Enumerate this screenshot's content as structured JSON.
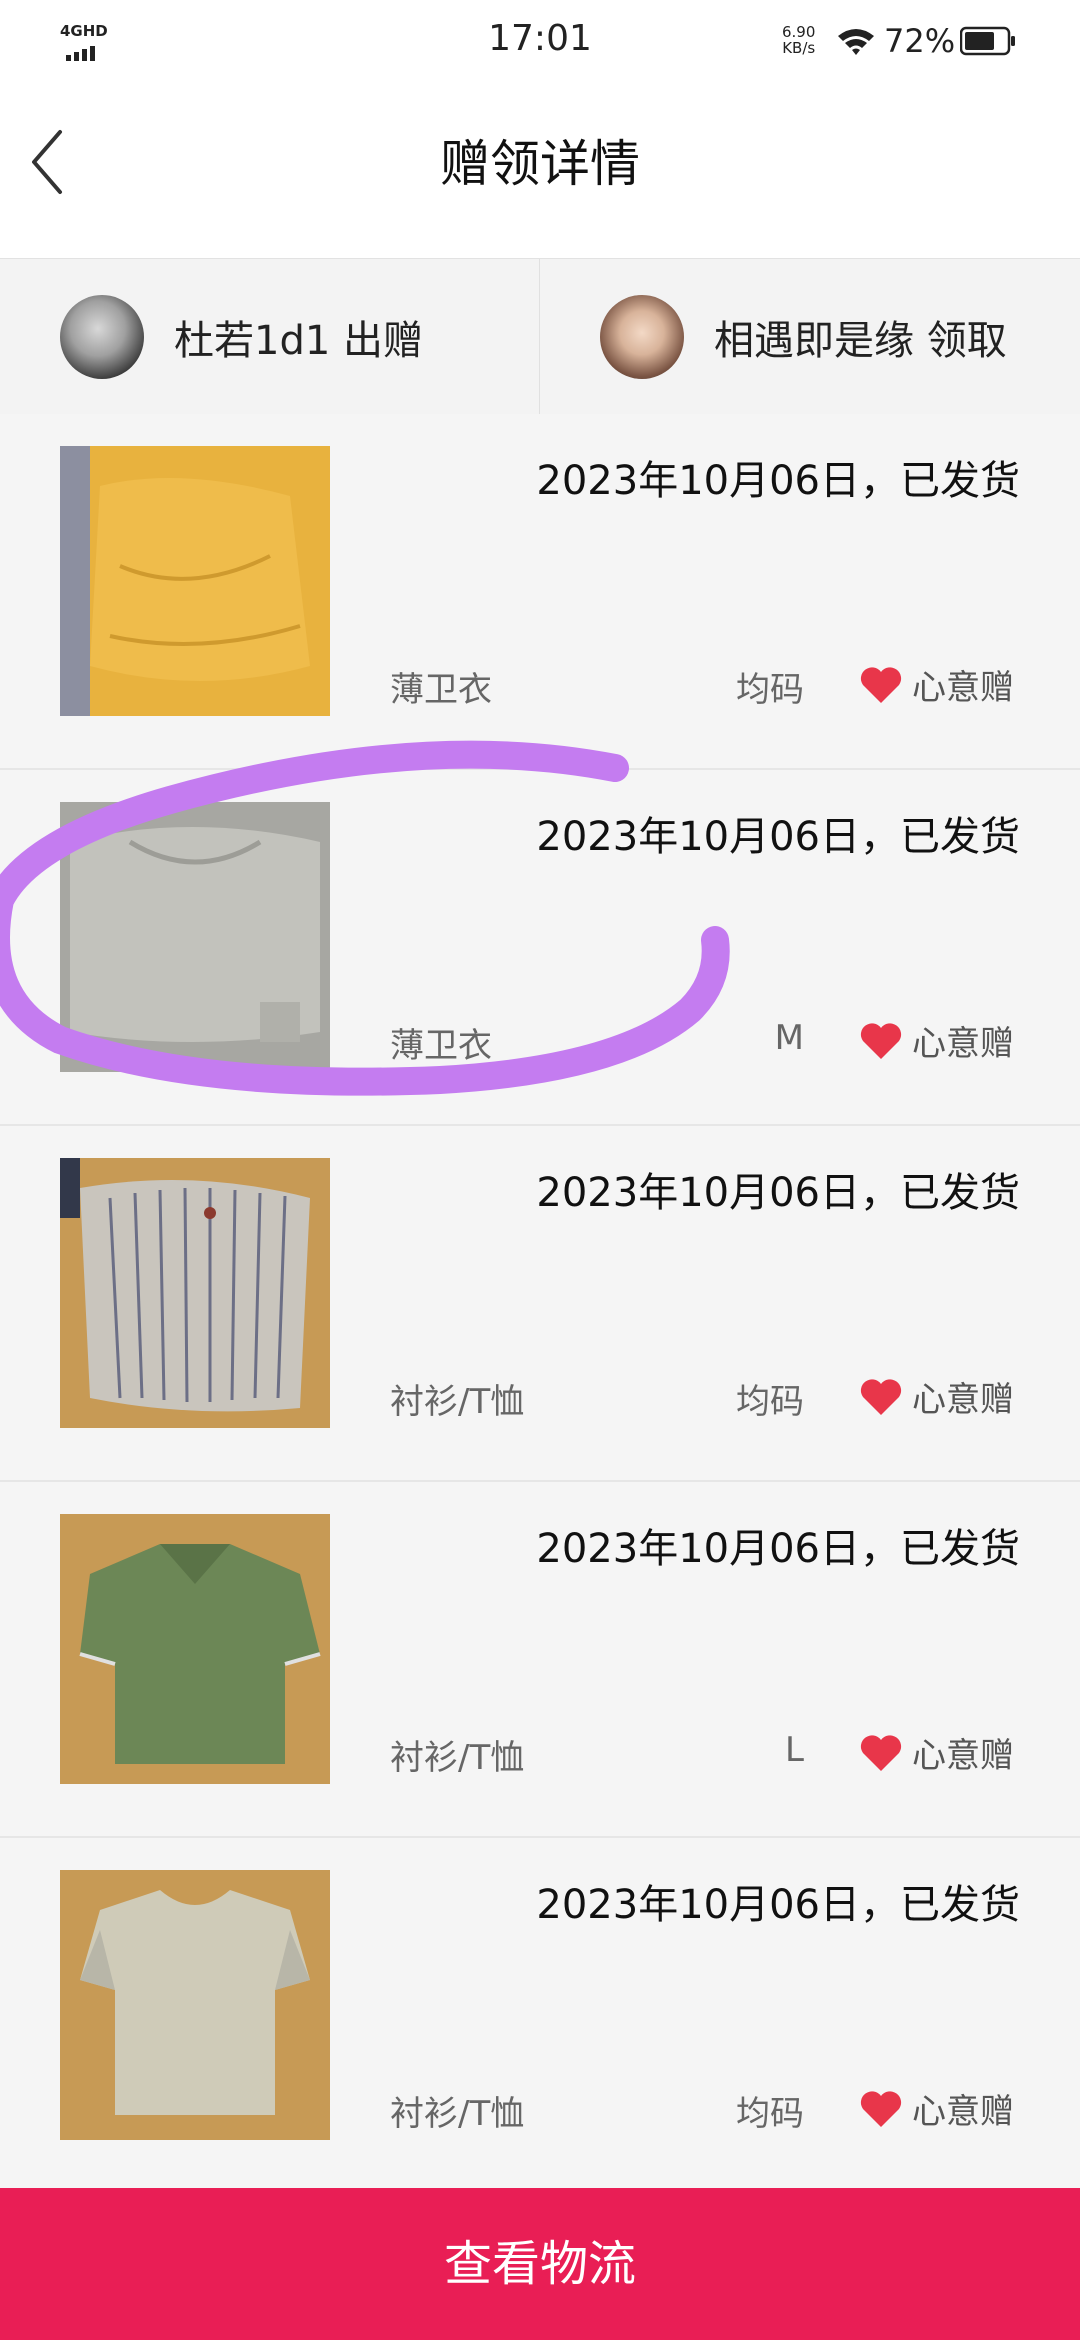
{
  "status_bar": {
    "network": "4GHD",
    "time": "17:01",
    "speed_value": "6.90",
    "speed_unit": "KB/s",
    "battery": "72%"
  },
  "header": {
    "title": "赠领详情"
  },
  "users": {
    "giver": "杜若1d1 出赠",
    "receiver": "相遇即是缘 领取"
  },
  "items": [
    {
      "date": "2023年10月06日，已发货",
      "category": "薄卫衣",
      "size": "均码",
      "gift": "心意赠",
      "thumb_color": "#e9b341"
    },
    {
      "date": "2023年10月06日，已发货",
      "category": "薄卫衣",
      "size": "M",
      "gift": "心意赠",
      "thumb_color": "#b9b9b3"
    },
    {
      "date": "2023年10月06日，已发货",
      "category": "衬衫/T恤",
      "size": "均码",
      "gift": "心意赠",
      "thumb_color": "#bdb6aa"
    },
    {
      "date": "2023年10月06日，已发货",
      "category": "衬衫/T恤",
      "size": "L",
      "gift": "心意赠",
      "thumb_color": "#6b8658"
    },
    {
      "date": "2023年10月06日，已发货",
      "category": "衬衫/T恤",
      "size": "均码",
      "gift": "心意赠",
      "thumb_color": "#c8c4b0"
    }
  ],
  "bottom_button": {
    "label": "查看物流"
  },
  "colors": {
    "accent": "#e91e55",
    "heart": "#e8364a",
    "annotation": "#c47cf0"
  }
}
